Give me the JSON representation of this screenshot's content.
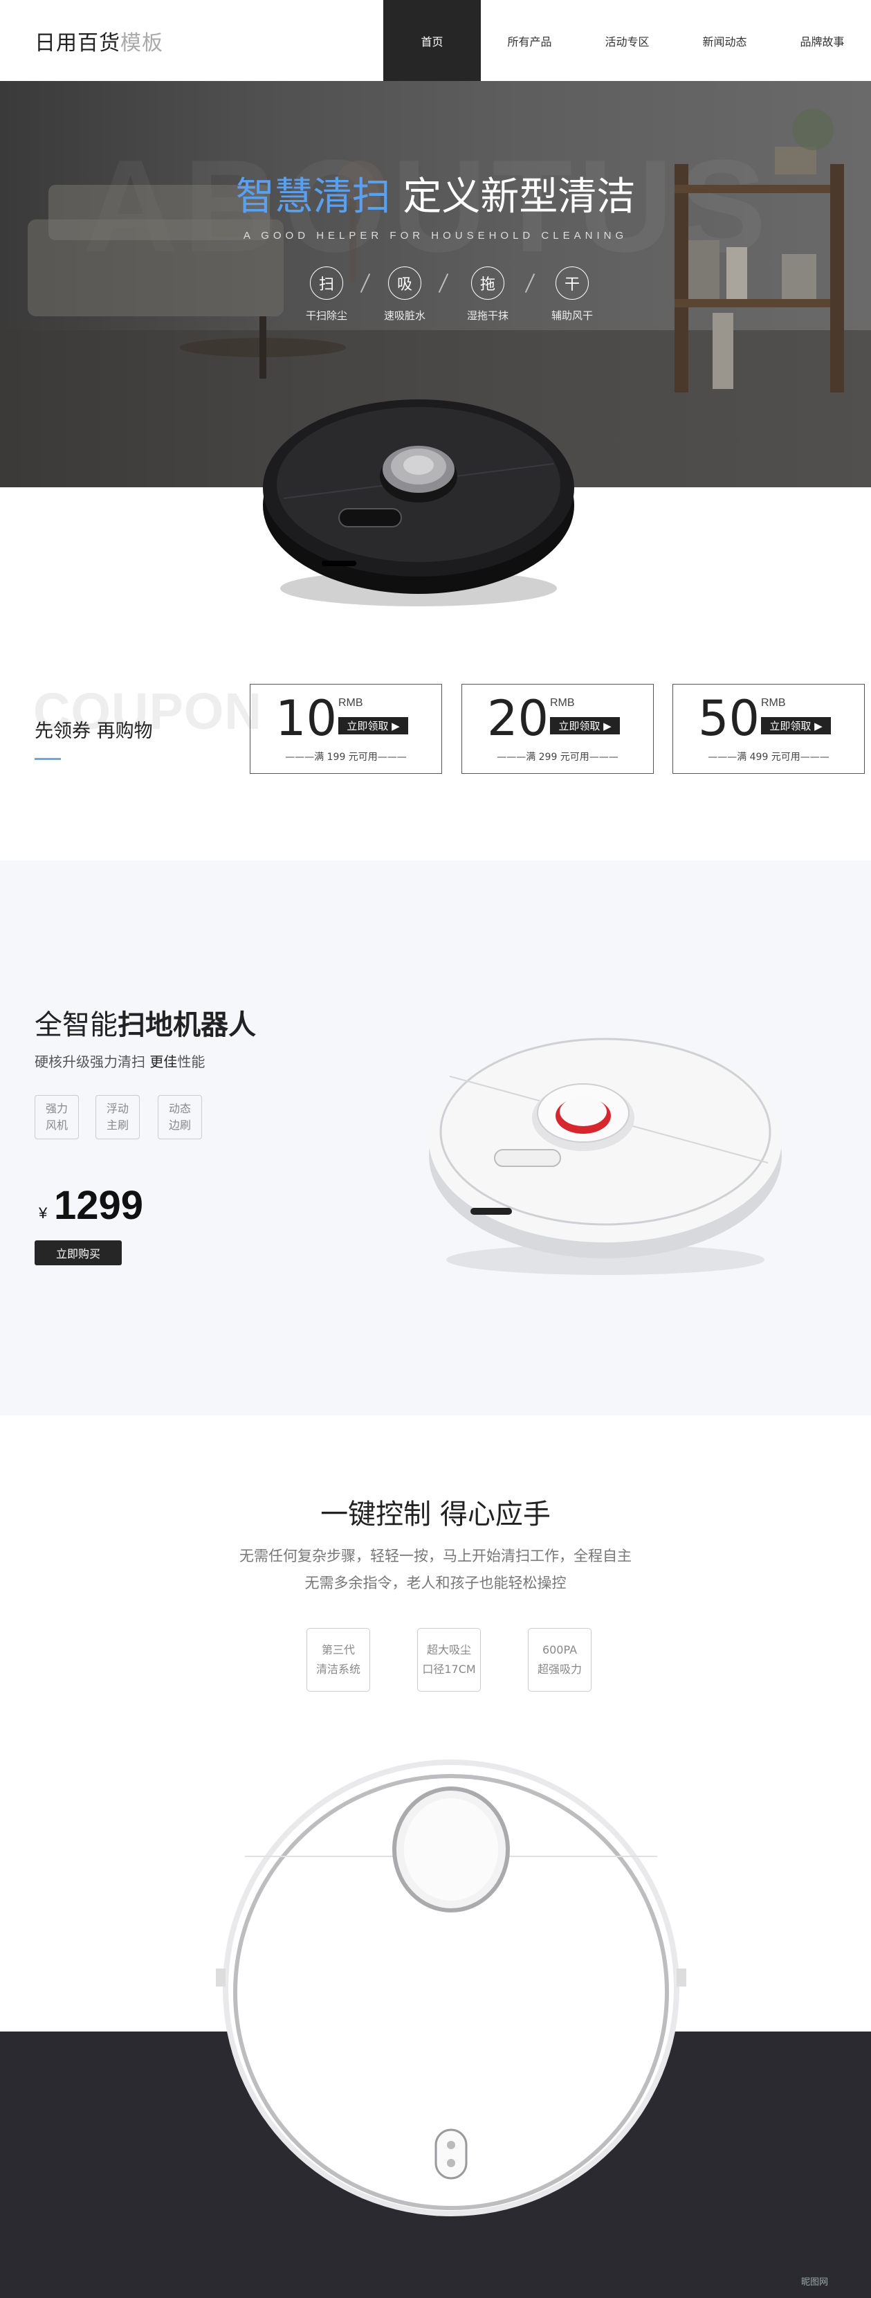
{
  "header": {
    "logo_main": "日用百货",
    "logo_sub": "模板",
    "nav": [
      "首页",
      "所有产品",
      "活动专区",
      "新闻动态",
      "品牌故事"
    ]
  },
  "hero": {
    "bg_word": "ABOUTUS",
    "title_highlight": "智慧清扫",
    "title_rest": " 定义新型清洁",
    "subtitle": "A GOOD HELPER FOR HOUSEHOLD CLEANING",
    "features": [
      {
        "icon": "扫",
        "label": "干扫除尘"
      },
      {
        "icon": "吸",
        "label": "速吸脏水"
      },
      {
        "icon": "拖",
        "label": "湿拖干抹"
      },
      {
        "icon": "干",
        "label": "辅助风干"
      }
    ]
  },
  "coupons": {
    "bg_word": "COUPON",
    "title": "先领券  再购物",
    "items": [
      {
        "amount": "10",
        "unit": "RMB",
        "button": "立即领取 ▶",
        "condition": "———满 199 元可用———"
      },
      {
        "amount": "20",
        "unit": "RMB",
        "button": "立即领取 ▶",
        "condition": "———满 299 元可用———"
      },
      {
        "amount": "50",
        "unit": "RMB",
        "button": "立即领取 ▶",
        "condition": "———满 499 元可用———"
      }
    ]
  },
  "product": {
    "title_a": "全智能",
    "title_b": "扫地机器人",
    "desc_a": "硬核升级强力清扫  ",
    "desc_b": "更佳",
    "desc_c": "性能",
    "tags": [
      [
        "强力",
        "风机"
      ],
      [
        "浮动",
        "主刷"
      ],
      [
        "动态",
        "边刷"
      ]
    ],
    "currency": "¥",
    "price": "1299",
    "buy_label": "立即购买"
  },
  "control": {
    "title": "一键控制 得心应手",
    "desc_line1": "无需任何复杂步骤，轻轻一按，马上开始清扫工作，全程自主",
    "desc_line2": "无需多余指令，老人和孩子也能轻松操控",
    "tags": [
      [
        "第三代",
        "清洁系统"
      ],
      [
        "超大吸尘",
        "口径17CM"
      ],
      [
        "600PA",
        "超强吸力"
      ]
    ]
  },
  "watermark": "昵图网",
  "colors": {
    "accent": "#5aa0f0",
    "dark": "#262626",
    "light_bg": "#f6f7fb",
    "band": "#2b2a30"
  }
}
